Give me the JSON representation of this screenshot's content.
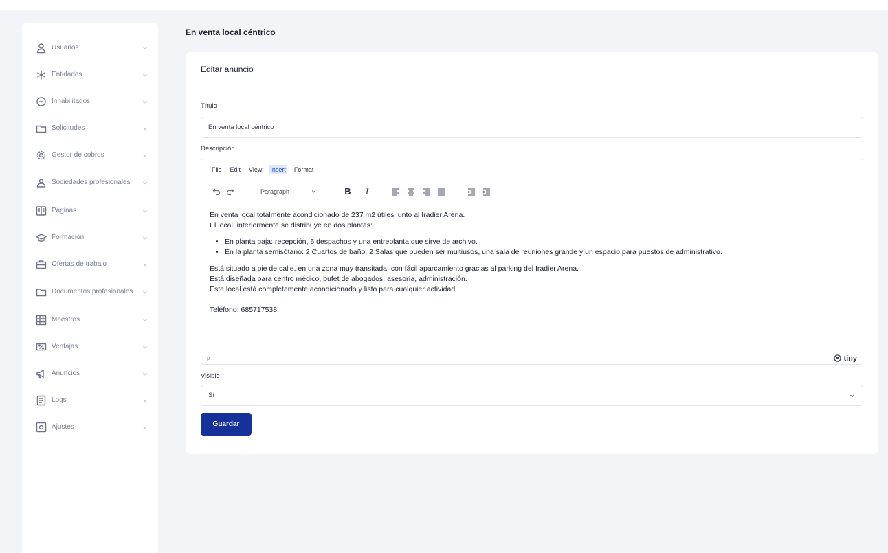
{
  "sidebar": {
    "items": [
      {
        "label": "Usuarios",
        "icon": "user-icon"
      },
      {
        "label": "Entidades",
        "icon": "asterisk-icon"
      },
      {
        "label": "Inhabilitados",
        "icon": "blocked-icon"
      },
      {
        "label": "Solicitudes",
        "icon": "folder-icon"
      },
      {
        "label": "Gestor de cobros",
        "icon": "gear-icon"
      },
      {
        "label": "Sociedades profesionales",
        "icon": "group-icon"
      },
      {
        "label": "Páginas",
        "icon": "pages-icon"
      },
      {
        "label": "Formación",
        "icon": "graduation-icon"
      },
      {
        "label": "Ofertas de trabajo",
        "icon": "briefcase-icon"
      },
      {
        "label": "Documentos profesionales",
        "icon": "document-folder-icon"
      },
      {
        "label": "Maestros",
        "icon": "grid-icon"
      },
      {
        "label": "Ventajas",
        "icon": "percent-tag-icon"
      },
      {
        "label": "Anuncios",
        "icon": "megaphone-icon"
      },
      {
        "label": "Logs",
        "icon": "log-icon"
      },
      {
        "label": "Ajustes",
        "icon": "settings-icon"
      }
    ]
  },
  "page": {
    "title": "En venta local céntrico"
  },
  "card": {
    "header": "Editar anuncio"
  },
  "form": {
    "title_label": "Título",
    "title_value": "En venta local céntrico",
    "description_label": "Descripción",
    "visible_label": "Visible",
    "visible_value": "Sí",
    "save_label": "Guardar"
  },
  "editor": {
    "menu": [
      "File",
      "Edit",
      "View",
      "Insert",
      "Format"
    ],
    "active_menu": "Insert",
    "block_format": "Paragraph",
    "status_path": "p",
    "brand": "tiny",
    "content": {
      "p1": "En venta local totalmente acondicionado de 237 m2 útiles junto al Iradier Arena.",
      "p2": "El local, interiormente se distribuye en dos plantas:",
      "bullets": [
        "En planta baja: recepción, 6 despachos y una entreplanta que sirve de archivo.",
        "En la planta semisótano: 2 Cuartos de baño, 2 Salas que pueden ser multiusos, una sala de reuniones grande y un espacio para puestos de administrativo."
      ],
      "p3": "Está situado a pie de calle, en una zona muy transitada, con fácil aparcamiento gracias al parking del Iradier Arena.",
      "p4": "Está diseñada para centro médico, bufet de abogados, asesoría, administración.",
      "p5": "Este local está completamente acondicionado y listo para cualquier actividad.",
      "phone": "Teléfono: 685717538"
    }
  },
  "colors": {
    "primary": "#14329a",
    "background": "#f3f4f8",
    "active_menu_bg": "#dfe8ff"
  }
}
